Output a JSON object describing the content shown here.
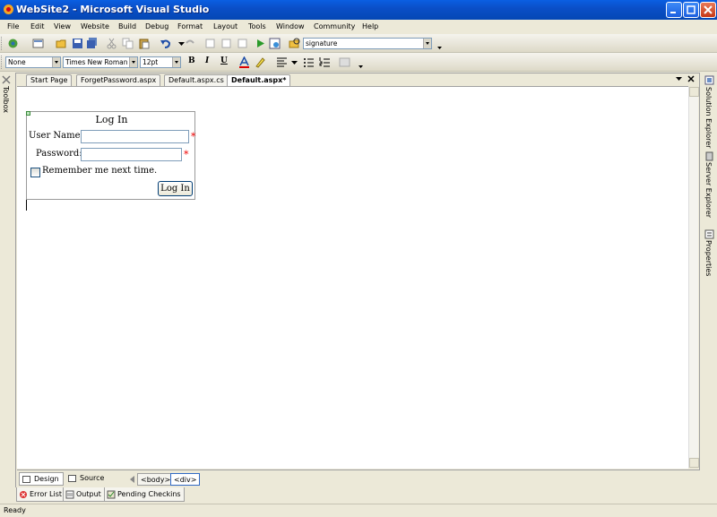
{
  "window": {
    "title": "WebSite2 - Microsoft Visual Studio"
  },
  "menu": [
    "File",
    "Edit",
    "View",
    "Website",
    "Build",
    "Debug",
    "Format",
    "Layout",
    "Tools",
    "Window",
    "Community",
    "Help"
  ],
  "toolbar1": {
    "search_value": "signature"
  },
  "toolbar2": {
    "style_value": "None",
    "font_value": "Times New Roman",
    "size_value": "12pt",
    "bold": "B",
    "italic": "I",
    "underline": "U"
  },
  "left_panel": {
    "toolbox_label": "Toolbox"
  },
  "right_panel": {
    "solution_explorer": "Solution Explorer",
    "server_explorer": "Server Explorer",
    "properties": "Properties"
  },
  "tabs": [
    {
      "label": "Start Page",
      "active": false
    },
    {
      "label": "ForgetPassword.aspx",
      "active": false
    },
    {
      "label": "Default.aspx.cs",
      "active": false
    },
    {
      "label": "Default.aspx*",
      "active": true
    }
  ],
  "login": {
    "title": "Log In",
    "username_label": "User Name:",
    "username_value": "",
    "password_label": "Password:",
    "password_value": "",
    "required_marker": "*",
    "remember_label": "Remember me next time.",
    "remember_checked": false,
    "button_label": "Log In"
  },
  "viewbar": {
    "design": "Design",
    "source": "Source",
    "crumbs": [
      "<body>",
      "<div>"
    ]
  },
  "bottom_tabs": [
    "Error List",
    "Output",
    "Pending Checkins"
  ],
  "status": {
    "text": "Ready"
  },
  "colors": {
    "titlebar": "#0a4fc8",
    "chrome": "#ece9d8",
    "required": "#e00000"
  }
}
